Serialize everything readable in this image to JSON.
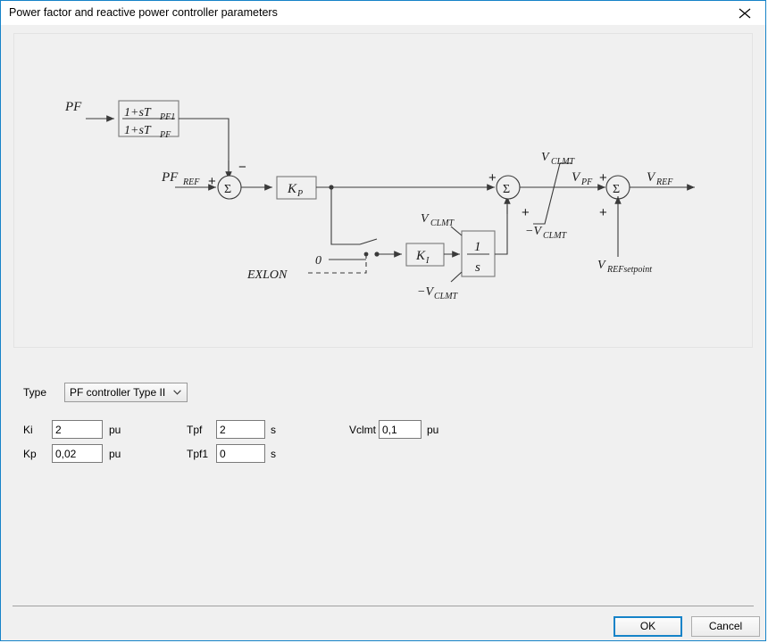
{
  "window": {
    "title": "Power factor and reactive power controller parameters",
    "close_icon": "close-icon"
  },
  "diagram": {
    "labels": {
      "pf_input": "PF",
      "lead_lag_num": "1+sT",
      "lead_lag_num_sub": "PF1",
      "lead_lag_den": "1+sT",
      "lead_lag_den_sub": "PF",
      "pf_ref": "PF",
      "pf_ref_sub": "REF",
      "sum1_plus": "+",
      "sum1_minus": "−",
      "sum_symbol": "Σ",
      "kp_block": "K",
      "kp_block_sub": "P",
      "ki_block": "K",
      "ki_block_sub": "I",
      "integrator_num": "1",
      "integrator_den": "s",
      "switch_zero": "0",
      "switch_exlon": "EXLON",
      "int_limit_upper": "V",
      "int_limit_upper_sub": "CLMT",
      "int_limit_lower": "−V",
      "int_limit_lower_sub": "CLMT",
      "sum2_plus_top": "+",
      "sum2_plus_bottom": "+",
      "limiter_upper": "V",
      "limiter_upper_sub": "CLMT",
      "limiter_lower": "−V",
      "limiter_lower_sub": "CLMT",
      "v_pf": "V",
      "v_pf_sub": "PF",
      "sum3_plus_top": "+",
      "sum3_plus_bottom": "+",
      "v_ref": "V",
      "v_ref_sub": "REF",
      "v_ref_setpoint": "V",
      "v_ref_setpoint_sub": "REFsetpoint"
    }
  },
  "form": {
    "type_label": "Type",
    "type_value": "PF controller Type II",
    "fields": [
      {
        "label": "Ki",
        "value": "2",
        "unit": "pu"
      },
      {
        "label": "Kp",
        "value": "0,02",
        "unit": "pu"
      },
      {
        "label": "Tpf",
        "value": "2",
        "unit": "s"
      },
      {
        "label": "Tpf1",
        "value": "0",
        "unit": "s"
      },
      {
        "label": "Vclmt",
        "value": "0,1",
        "unit": "pu"
      }
    ]
  },
  "footer": {
    "ok_label": "OK",
    "cancel_label": "Cancel"
  },
  "colors": {
    "accent": "#1683c8",
    "dialog_bg": "#f0f0f0",
    "diagram_line": "#3a3a3a"
  }
}
